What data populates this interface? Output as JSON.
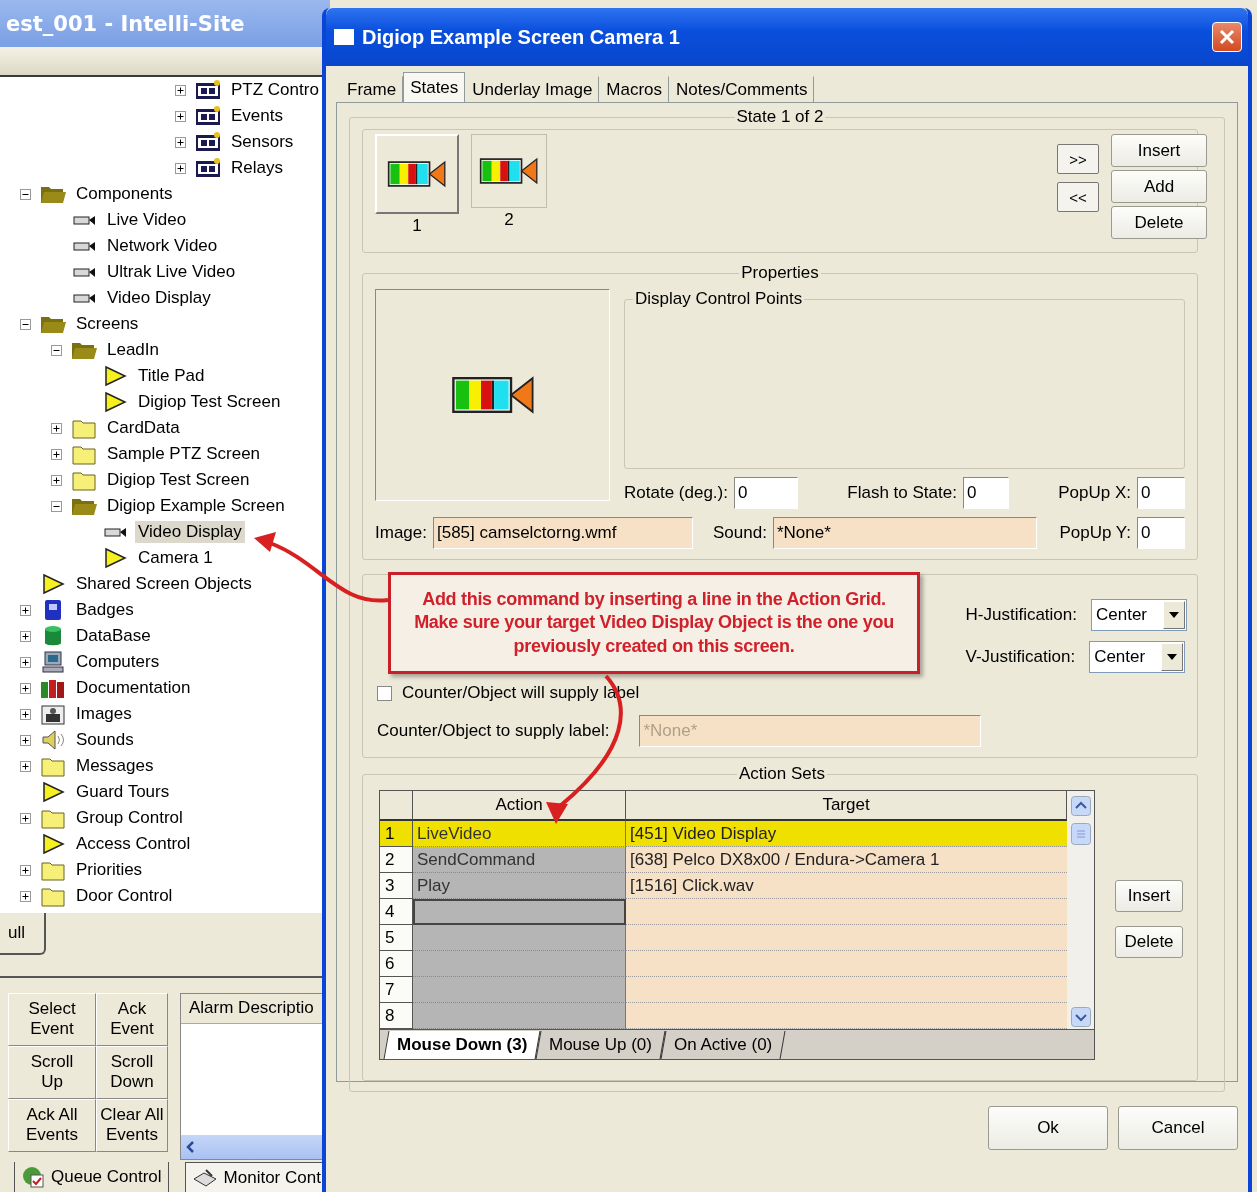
{
  "main_window": {
    "title": "est_001 - Intelli-Site",
    "tree_partial": [
      {
        "label": "PTZ Contro",
        "kind": "macro",
        "expanded": false,
        "selected": false
      },
      {
        "label": "Events",
        "kind": "macro",
        "expanded": false,
        "selected": false
      },
      {
        "label": "Sensors",
        "kind": "macro",
        "expanded": false,
        "selected": false
      },
      {
        "label": "Relays",
        "kind": "macro",
        "expanded": false,
        "selected": false
      }
    ],
    "tree": [
      {
        "label": "Components",
        "kind": "folder",
        "expanded": true,
        "selected": false,
        "children": [
          {
            "label": "Live Video",
            "kind": "camera",
            "selected": false
          },
          {
            "label": "Network Video",
            "kind": "camera",
            "selected": false
          },
          {
            "label": "Ultrak Live Video",
            "kind": "camera",
            "selected": false
          },
          {
            "label": "Video Display",
            "kind": "camera",
            "selected": false
          }
        ]
      },
      {
        "label": "Screens",
        "kind": "folder",
        "expanded": true,
        "selected": false,
        "children": [
          {
            "label": "LeadIn",
            "kind": "folder",
            "expanded": true,
            "selected": false,
            "children": [
              {
                "label": "Title Pad",
                "kind": "screen",
                "selected": false
              },
              {
                "label": "Digiop Test Screen",
                "kind": "screen",
                "selected": false
              }
            ]
          },
          {
            "label": "CardData",
            "kind": "folder",
            "expanded": false,
            "selected": false
          },
          {
            "label": "Sample PTZ Screen",
            "kind": "folder",
            "expanded": false,
            "selected": false
          },
          {
            "label": "Digiop Test Screen",
            "kind": "folder",
            "expanded": false,
            "selected": false
          },
          {
            "label": "Digiop Example Screen",
            "kind": "folder",
            "expanded": true,
            "selected": false,
            "children": [
              {
                "label": "Video Display",
                "kind": "camera",
                "selected": true
              },
              {
                "label": "Camera 1",
                "kind": "screen",
                "selected": false
              }
            ]
          }
        ]
      },
      {
        "label": "Shared Screen Objects",
        "kind": "screen",
        "selected": false
      },
      {
        "label": "Badges",
        "kind": "badge",
        "expanded": false,
        "selected": false
      },
      {
        "label": "DataBase",
        "kind": "database",
        "expanded": false,
        "selected": false
      },
      {
        "label": "Computers",
        "kind": "computer",
        "expanded": false,
        "selected": false
      },
      {
        "label": "Documentation",
        "kind": "books",
        "expanded": false,
        "selected": false
      },
      {
        "label": "Images",
        "kind": "images",
        "expanded": false,
        "selected": false
      },
      {
        "label": "Sounds",
        "kind": "speaker",
        "expanded": false,
        "selected": false
      },
      {
        "label": "Messages",
        "kind": "folder",
        "expanded": false,
        "selected": false
      },
      {
        "label": "Guard Tours",
        "kind": "screen",
        "selected": false
      },
      {
        "label": "Group Control",
        "kind": "folder",
        "expanded": false,
        "selected": false
      },
      {
        "label": "Access Control",
        "kind": "screen",
        "selected": false
      },
      {
        "label": "Priorities",
        "kind": "folder",
        "expanded": false,
        "selected": false
      },
      {
        "label": "Door Control",
        "kind": "folder",
        "expanded": false,
        "selected": false
      }
    ],
    "tab_fragment": "ull",
    "event_buttons": [
      "Select Event",
      "Ack Event",
      "Scroll Up",
      "Scroll Down",
      "Ack All Events",
      "Clear All Events"
    ],
    "alarm_column": "Alarm Descriptio",
    "bottom_tabs": [
      {
        "label": "Queue Control",
        "kind": "queue",
        "selected": true
      },
      {
        "label": "Monitor Cont",
        "kind": "monitor",
        "selected": false
      }
    ]
  },
  "dialog": {
    "title": "Digiop Example Screen Camera 1",
    "tabs": [
      {
        "label": "Frame",
        "selected": false
      },
      {
        "label": "States",
        "selected": true
      },
      {
        "label": "Underlay Image",
        "selected": false
      },
      {
        "label": "Macros",
        "selected": false
      },
      {
        "label": "Notes/Comments",
        "selected": false
      }
    ],
    "state_group": "State 1 of 2",
    "states": [
      {
        "label": "1",
        "selected": true
      },
      {
        "label": "2",
        "selected": false
      }
    ],
    "nav_buttons": [
      ">>",
      "<<"
    ],
    "state_buttons": [
      "Insert",
      "Add",
      "Delete"
    ],
    "properties": {
      "title": "Properties",
      "control_points": "Display Control Points",
      "rotate": {
        "label": "Rotate (deg.):",
        "value": "0"
      },
      "flash": {
        "label": "Flash to State:",
        "value": "0"
      },
      "popup_x": {
        "label": "PopUp X:",
        "value": "0"
      },
      "image": {
        "label": "Image:",
        "value": "[585] camselctorng.wmf"
      },
      "sound": {
        "label": "Sound:",
        "value": "*None*"
      },
      "popup_y": {
        "label": "PopUp Y:",
        "value": "0"
      }
    },
    "label_group": {
      "h_justification": {
        "label": "H-Justification:",
        "value": "Center"
      },
      "v_justification": {
        "label": "V-Justification:",
        "value": "Center"
      },
      "supply_checkbox": {
        "label": "Counter/Object will supply label",
        "checked": false
      },
      "supply_field": {
        "label": "Counter/Object to supply label:",
        "value": "*None*",
        "disabled": true
      }
    },
    "action_sets": {
      "title": "Action Sets",
      "columns": [
        "Action",
        "Target"
      ],
      "rows": [
        {
          "number": "1",
          "action": "LiveVideo",
          "target": "[451] Video Display",
          "highlighted": true,
          "focused": false
        },
        {
          "number": "2",
          "action": "SendCommand",
          "target": "[638] Pelco DX8x00 / Endura->Camera 1",
          "highlighted": false,
          "focused": false
        },
        {
          "number": "3",
          "action": "Play",
          "target": "[1516] Click.wav",
          "highlighted": false,
          "focused": false
        },
        {
          "number": "4",
          "highlighted": false,
          "focused": true
        },
        {
          "number": "5",
          "highlighted": false,
          "focused": false
        },
        {
          "number": "6",
          "highlighted": false,
          "focused": false
        },
        {
          "number": "7",
          "highlighted": false,
          "focused": false
        },
        {
          "number": "8",
          "highlighted": false,
          "focused": false
        }
      ],
      "set_tabs": [
        {
          "label": "Mouse Down (3)",
          "selected": true
        },
        {
          "label": "Mouse Up (0)",
          "selected": false
        },
        {
          "label": "On Active (0)",
          "selected": false
        }
      ],
      "buttons": [
        "Insert",
        "Delete"
      ]
    },
    "footer_buttons": [
      "Ok",
      "Cancel"
    ]
  },
  "callout": {
    "text": "Add this command by inserting a line in the Action Grid. Make sure your target Video Display Object is the one you previously created on this screen."
  }
}
